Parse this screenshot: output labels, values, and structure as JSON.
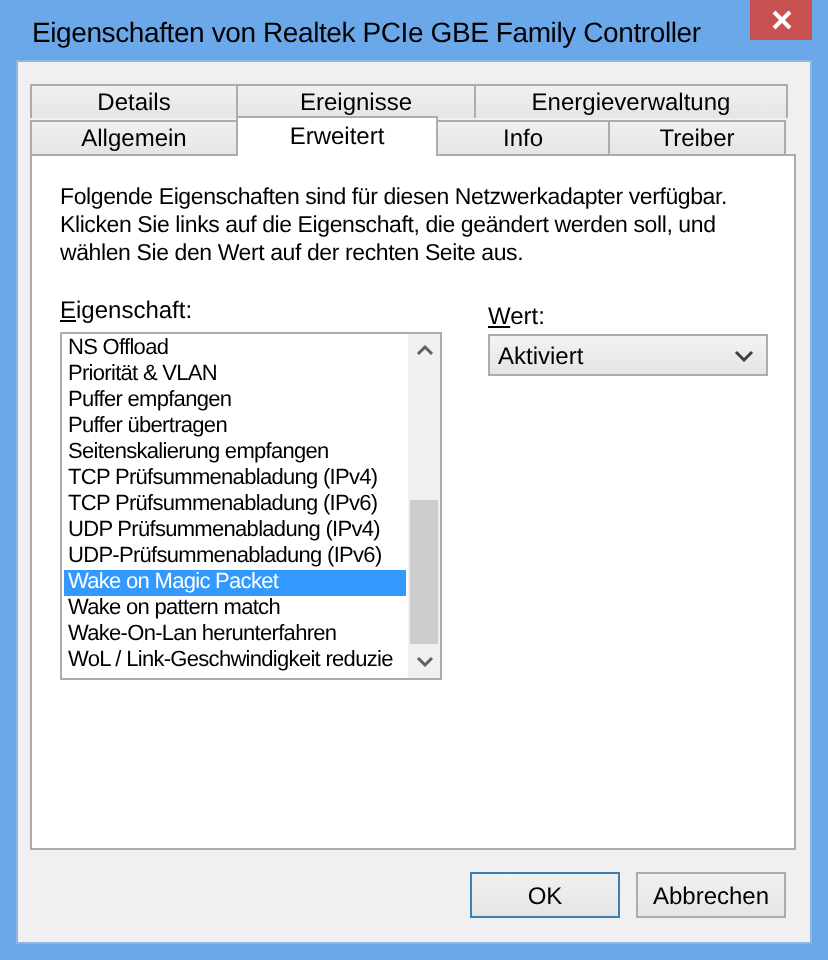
{
  "window": {
    "title": "Eigenschaften von Realtek PCIe GBE Family Controller"
  },
  "tabs": [
    [
      {
        "label": "Details",
        "selected": false
      },
      {
        "label": "Ereignisse",
        "selected": false
      },
      {
        "label": "Energieverwaltung",
        "selected": false
      }
    ],
    [
      {
        "label": "Allgemein",
        "selected": false
      },
      {
        "label": "Erweitert",
        "selected": true
      },
      {
        "label": "Info",
        "selected": false
      },
      {
        "label": "Treiber",
        "selected": false
      }
    ]
  ],
  "description": [
    "Folgende Eigenschaften sind für diesen Netzwerkadapter verfügbar.",
    "Klicken Sie links auf die Eigenschaft, die geändert werden soll, und",
    "wählen Sie den Wert auf der rechten Seite aus."
  ],
  "property": {
    "label": "Eigenschaft:",
    "items": [
      {
        "label": "NS Offload",
        "selected": false
      },
      {
        "label": "Priorität & VLAN",
        "selected": false
      },
      {
        "label": "Puffer empfangen",
        "selected": false
      },
      {
        "label": "Puffer übertragen",
        "selected": false
      },
      {
        "label": "Seitenskalierung empfangen",
        "selected": false
      },
      {
        "label": "TCP Prüfsummenabladung (IPv4)",
        "selected": false
      },
      {
        "label": "TCP Prüfsummenabladung (IPv6)",
        "selected": false
      },
      {
        "label": "UDP Prüfsummenabladung (IPv4)",
        "selected": false
      },
      {
        "label": "UDP-Prüfsummenabladung (IPv6)",
        "selected": false
      },
      {
        "label": "Wake on Magic Packet",
        "selected": true
      },
      {
        "label": "Wake on pattern match",
        "selected": false
      },
      {
        "label": "Wake-On-Lan herunterfahren",
        "selected": false
      },
      {
        "label": "WoL / Link-Geschwindigkeit reduzie",
        "selected": false
      }
    ]
  },
  "value": {
    "label": "Wert:",
    "value": "Aktiviert"
  },
  "buttons": [
    {
      "label": "OK",
      "default": true
    },
    {
      "label": "Abbrechen",
      "default": false
    }
  ]
}
